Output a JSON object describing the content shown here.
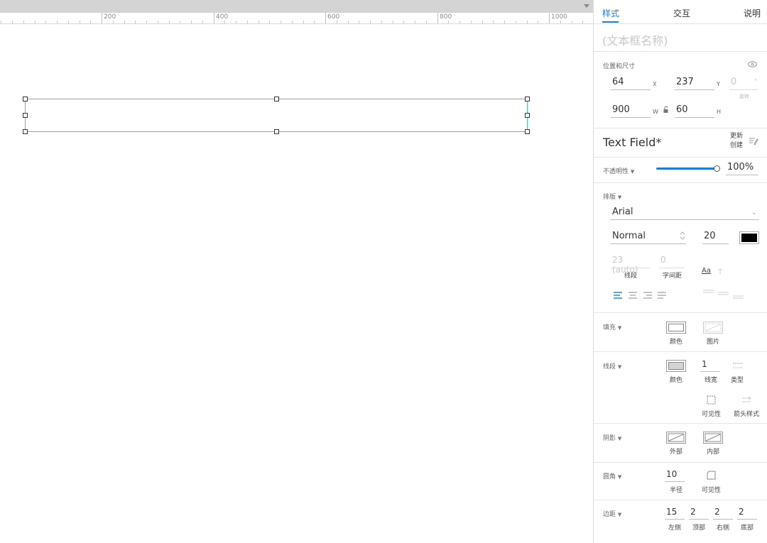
{
  "ruler": {
    "labels": [
      "200",
      "400",
      "600",
      "800",
      "1000"
    ]
  },
  "tabs": {
    "style": "样式",
    "interaction": "交互",
    "notes": "说明"
  },
  "widget_name_placeholder": "(文本框名称)",
  "position": {
    "section_label": "位置和尺寸",
    "x": "64",
    "x_unit": "X",
    "y": "237",
    "y_unit": "Y",
    "rotation": "0",
    "rotation_unit": "°",
    "rotation_label": "旋转",
    "w": "900",
    "w_unit": "W",
    "h": "60",
    "h_unit": "H"
  },
  "style_name": "Text Field*",
  "update_label": "更新",
  "create_label": "创建",
  "opacity": {
    "label": "不透明性",
    "value": "100%",
    "level": 1.0
  },
  "typography": {
    "label": "排版",
    "font": "Arial",
    "weight": "Normal",
    "size": "20",
    "color": "#000000",
    "line_spacing": "23 (auto)",
    "line_spacing_label": "线段",
    "char_spacing": "0",
    "char_spacing_label": "字间距",
    "aa_label": "Aa"
  },
  "fill": {
    "label": "填充",
    "color_label": "颜色",
    "image_label": "图片"
  },
  "stroke": {
    "label": "线段",
    "color_label": "颜色",
    "width": "1",
    "width_label": "线宽",
    "type_label": "类型",
    "visibility_label": "可见性",
    "arrow_label": "箭头样式",
    "color": "#d3d3d3"
  },
  "shadow": {
    "label": "阴影",
    "outer_label": "外部",
    "inner_label": "内部"
  },
  "corner": {
    "label": "圆角",
    "radius": "10",
    "radius_label": "半径",
    "visibility_label": "可见性"
  },
  "padding": {
    "label": "边距",
    "left": "15",
    "left_label": "左侧",
    "top": "2",
    "top_label": "顶部",
    "right": "2",
    "right_label": "右侧",
    "bottom": "2",
    "bottom_label": "底部"
  },
  "colors": {
    "accent": "#1a7fd1",
    "selection": "#35c8d6"
  }
}
